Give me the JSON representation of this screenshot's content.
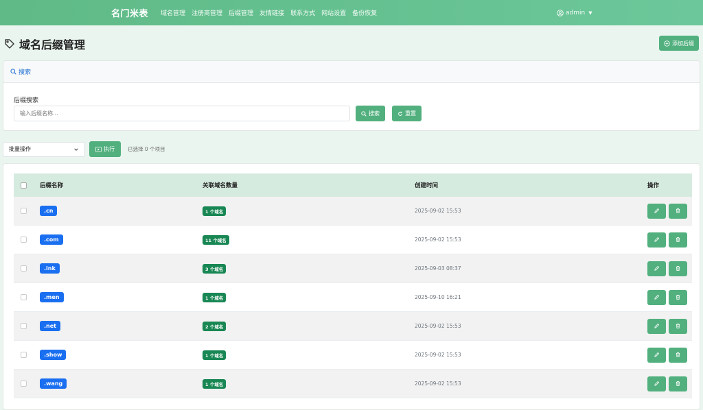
{
  "nav": {
    "brand": "名门米表",
    "links": [
      "域名管理",
      "注册商管理",
      "后缀管理",
      "友情链接",
      "联系方式",
      "网站设置",
      "备份恢复"
    ],
    "user": "admin"
  },
  "page": {
    "title": "域名后缀管理",
    "add_button": "添加后缀"
  },
  "search": {
    "header": "搜索",
    "field_label": "后缀搜索",
    "placeholder": "输入后缀名称...",
    "search_button": "搜索",
    "reset_button": "重置"
  },
  "bulk": {
    "select_value": "批量操作",
    "execute_button": "执行",
    "selected_info": "已选择 0 个项目"
  },
  "table": {
    "headers": {
      "name": "后缀名称",
      "count": "关联域名数量",
      "time": "创建时间",
      "actions": "操作"
    },
    "rows": [
      {
        "suffix": ".cn",
        "count": "1 个域名",
        "time": "2025-09-02 15:53"
      },
      {
        "suffix": ".com",
        "count": "11 个域名",
        "time": "2025-09-02 15:53"
      },
      {
        "suffix": ".ink",
        "count": "3 个域名",
        "time": "2025-09-03 08:37"
      },
      {
        "suffix": ".men",
        "count": "1 个域名",
        "time": "2025-09-10 16:21"
      },
      {
        "suffix": ".net",
        "count": "2 个域名",
        "time": "2025-09-02 15:53"
      },
      {
        "suffix": ".show",
        "count": "1 个域名",
        "time": "2025-09-02 15:53"
      },
      {
        "suffix": ".wang",
        "count": "1 个域名",
        "time": "2025-09-02 15:53"
      }
    ]
  },
  "colors": {
    "primary": "#52b07e",
    "suffix_badge": "#1a6ff0",
    "count_badge": "#198754",
    "nav": "#5fba87"
  }
}
